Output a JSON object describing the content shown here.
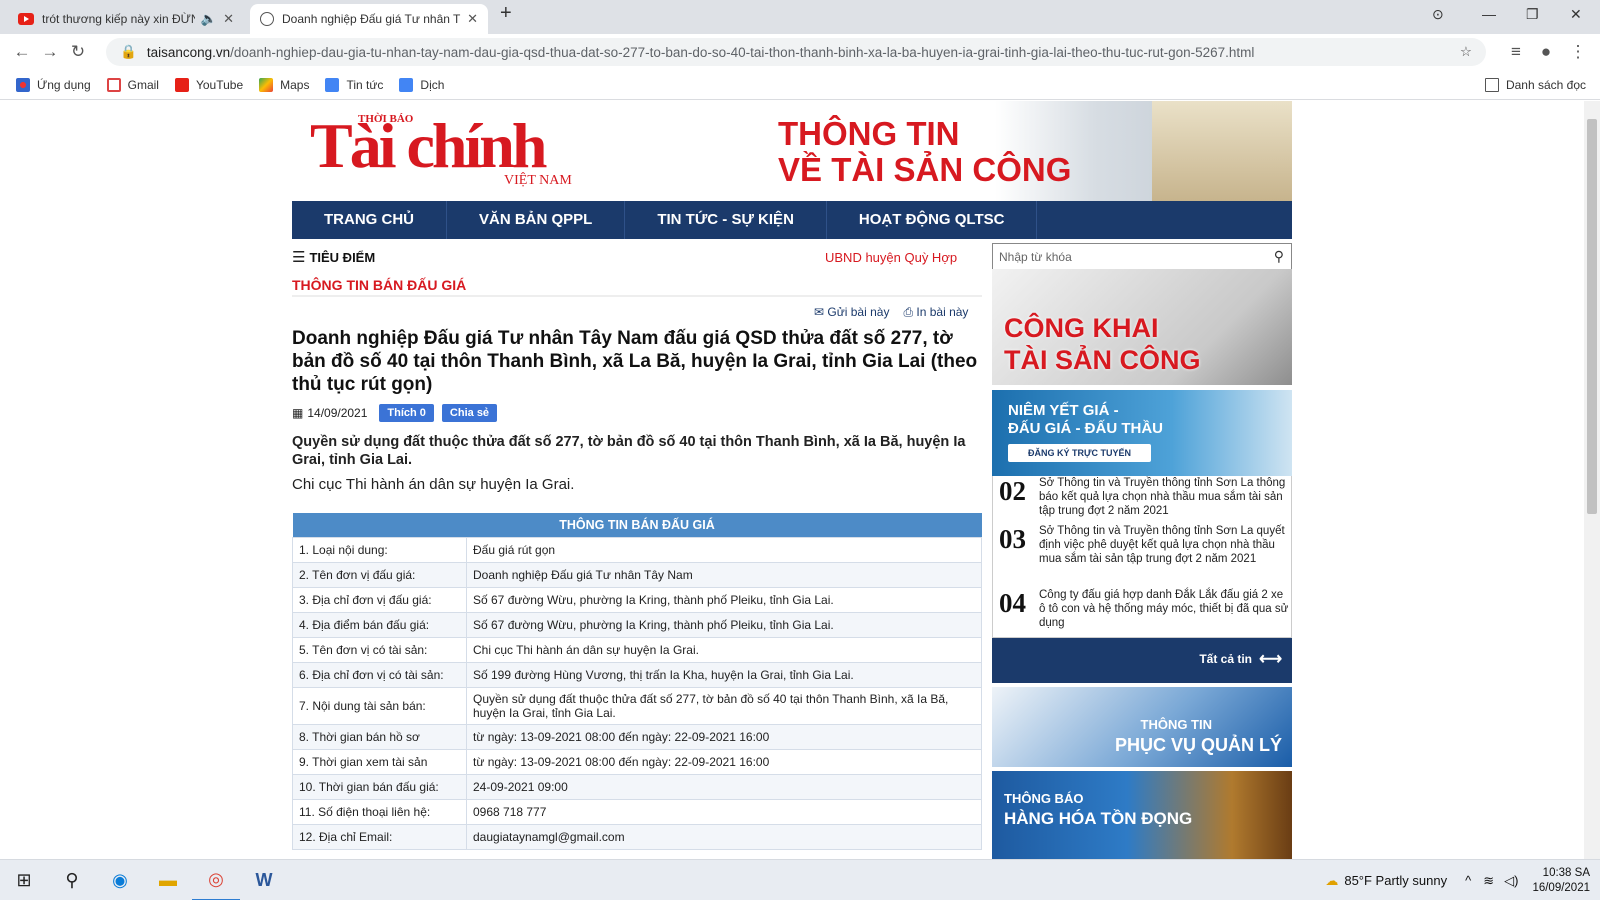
{
  "browser": {
    "tabs": [
      {
        "title": "trót thương kiếp này xin ĐỪNG",
        "active": false
      },
      {
        "title": "Doanh nghiệp Đấu giá Tư nhân T",
        "active": true
      }
    ],
    "new_tab": "+",
    "url_host": "taisancong.vn",
    "url_path": "/doanh-nghiep-dau-gia-tu-nhan-tay-nam-dau-gia-qsd-thua-dat-so-277-to-ban-do-so-40-tai-thon-thanh-binh-xa-la-ba-huyen-ia-grai-tinh-gia-lai-theo-thu-tuc-rut-gon-5267.html",
    "bookmarks": [
      "Ứng dụng",
      "Gmail",
      "YouTube",
      "Maps",
      "Tin tức",
      "Dịch"
    ],
    "reading_list": "Danh sách đọc"
  },
  "site": {
    "logo_small": "THỜI BÁO",
    "logo_big": "Tài chính",
    "logo_vn": "VIỆT NAM",
    "banner_line1": "THÔNG TIN",
    "banner_line2": "VỀ TÀI SẢN CÔNG",
    "nav": [
      "TRANG CHỦ",
      "VĂN BẢN QPPL",
      "TIN TỨC - SỰ KIỆN",
      "HOẠT ĐỘNG QLTSC"
    ],
    "tieu_diem": "TIÊU ĐIỂM",
    "ticker": "UBND huyện Quỳ Hợp n",
    "search_placeholder": "Nhập từ khóa"
  },
  "article": {
    "section": "THÔNG TIN BÁN ĐẤU GIÁ",
    "send": "Gửi bài này",
    "print": "In bài này",
    "title": "Doanh nghiệp Đấu giá Tư nhân Tây Nam đấu giá QSD thửa đất số 277, tờ bản đồ số 40 tại thôn Thanh Bình, xã La Bă, huyện Ia Grai, tỉnh Gia Lai (theo thủ tục rút gọn)",
    "date": "14/09/2021",
    "like": "Thích 0",
    "share": "Chia sẻ",
    "lead": "Quyền sử dụng đất thuộc thửa đất số 277, tờ bản đồ số 40 tại thôn Thanh Bình, xã Ia Bă, huyện Ia Grai, tỉnh Gia Lai.",
    "agency": "Chi cục Thi hành án dân sự huyện Ia Grai.",
    "table_title": "THÔNG TIN BÁN ĐẤU GIÁ",
    "rows": [
      {
        "k": "1. Loại nội dung:",
        "v": "Đấu giá rút gọn"
      },
      {
        "k": "2. Tên đơn vị đấu giá:",
        "v": "Doanh nghiệp Đấu giá Tư nhân Tây Nam"
      },
      {
        "k": "3. Địa chỉ đơn vị đấu giá:",
        "v": "Số 67 đường Wừu, phường Ia Kring, thành phố Pleiku, tỉnh Gia Lai."
      },
      {
        "k": "4. Địa điểm bán đấu giá:",
        "v": "Số 67 đường Wừu, phường Ia Kring, thành phố Pleiku, tỉnh Gia Lai."
      },
      {
        "k": "5. Tên đơn vị có tài sản:",
        "v": "Chi cục Thi hành án dân sự huyện Ia Grai."
      },
      {
        "k": "6. Địa chỉ đơn vị có tài sản:",
        "v": "Số 199 đường Hùng Vương, thị trấn Ia Kha, huyện Ia Grai, tỉnh Gia Lai."
      },
      {
        "k": "7. Nội dung tài sản bán:",
        "v": "Quyền sử dụng đất thuộc thửa đất số 277, tờ bản đồ số 40 tại thôn Thanh Bình, xã Ia Bă, huyện Ia Grai, tỉnh Gia Lai."
      },
      {
        "k": "8. Thời gian bán hồ sơ",
        "v": "từ ngày: 13-09-2021 08:00 đến ngày: 22-09-2021 16:00"
      },
      {
        "k": "9. Thời gian xem tài sản",
        "v": "từ ngày: 13-09-2021 08:00 đến ngày: 22-09-2021 16:00"
      },
      {
        "k": "10. Thời gian bán đấu giá:",
        "v": "24-09-2021 09:00"
      },
      {
        "k": "11. Số điện thoại liên hệ:",
        "v": "0968 718 777"
      },
      {
        "k": "12. Địa chỉ Email:",
        "v": "daugiataynamgl@gmail.com"
      }
    ]
  },
  "sidebar": {
    "ban1_l1": "CÔNG KHAI",
    "ban1_l2": "TÀI SẢN CÔNG",
    "ban2_l1": "NIÊM YẾT GIÁ -",
    "ban2_l2": "ĐẤU GIÁ - ĐẤU THẦU",
    "ban2_btn": "ĐĂNG KÝ TRỰC TUYẾN",
    "news": [
      {
        "n": "02",
        "t": "Sở Thông tin và Truyền thông tỉnh Sơn La thông báo kết quả lựa chọn nhà thầu mua sắm tài sản tập trung đợt 2 năm 2021"
      },
      {
        "n": "03",
        "t": "Sở Thông tin và Truyền thông tỉnh Sơn La quyết định việc phê duyệt kết quả lựa chọn nhà thầu mua sắm tài sản tập trung đợt 2 năm 2021"
      },
      {
        "n": "04",
        "t": "Công ty đấu giá hợp danh Đắk Lắk đấu giá 2 xe ô tô con và hệ thống máy móc, thiết bị đã qua sử dụng"
      }
    ],
    "all_news": "Tất cả tin",
    "ban3_l1": "THÔNG TIN",
    "ban3_l2": "PHỤC VỤ QUẢN LÝ",
    "ban4_l1": "THÔNG BÁO",
    "ban4_l2": "HÀNG HÓA TỒN ĐỌNG"
  },
  "taskbar": {
    "weather": "85°F  Partly sunny",
    "time": "10:38 SA",
    "date": "16/09/2021"
  }
}
